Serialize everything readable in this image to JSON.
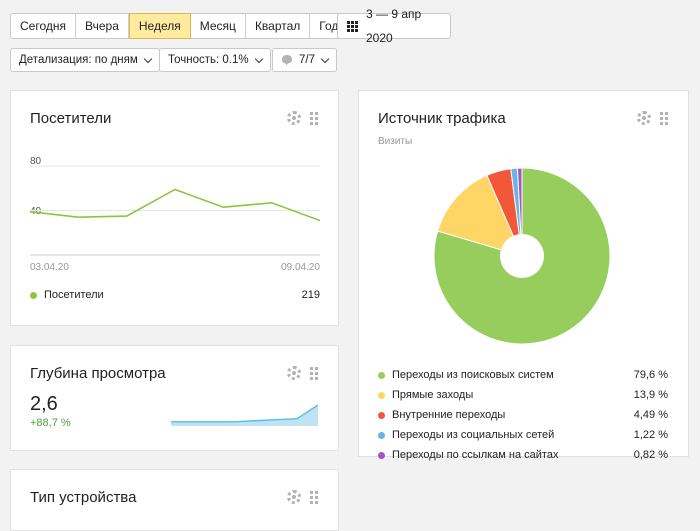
{
  "periods": [
    "Сегодня",
    "Вчера",
    "Неделя",
    "Месяц",
    "Квартал",
    "Год"
  ],
  "active_period": "Неделя",
  "date_range": "3 — 9 апр 2020",
  "detail_label": "Детализация: по дням",
  "accuracy_label": "Точность: 0.1%",
  "segments_label": "7/7",
  "visitors_card": {
    "title": "Посетители",
    "y_ticks": [
      "80",
      "40"
    ],
    "x_start": "03.04.20",
    "x_end": "09.04.20",
    "legend_label": "Посетители",
    "legend_value": "219",
    "color": "#8cc63f"
  },
  "depth_card": {
    "title": "Глубина просмотра",
    "value": "2,6",
    "change": "+88,7 %",
    "color": "#5bbde4"
  },
  "device_card": {
    "title": "Тип устройства"
  },
  "traffic_card": {
    "title": "Источник трафика",
    "subtitle": "Визиты",
    "sources": [
      {
        "label": "Переходы из поисковых систем",
        "value": "79,6 %",
        "pct": 79.6,
        "color": "#96cd5d"
      },
      {
        "label": "Прямые заходы",
        "value": "13,9 %",
        "pct": 13.9,
        "color": "#ffd666"
      },
      {
        "label": "Внутренние переходы",
        "value": "4,49 %",
        "pct": 4.49,
        "color": "#f2573a"
      },
      {
        "label": "Переходы из социальных сетей",
        "value": "1,22 %",
        "pct": 1.22,
        "color": "#6db2e6"
      },
      {
        "label": "Переходы по ссылкам на сайтах",
        "value": "0,82 %",
        "pct": 0.82,
        "color": "#a254c9"
      }
    ]
  },
  "chart_data": [
    {
      "type": "line",
      "title": "Посетители",
      "x": [
        "03.04.20",
        "04.04.20",
        "05.04.20",
        "06.04.20",
        "07.04.20",
        "08.04.20",
        "09.04.20"
      ],
      "series": [
        {
          "name": "Посетители",
          "values": [
            39,
            34,
            35,
            59,
            43,
            47,
            31
          ]
        }
      ],
      "ylim": [
        0,
        90
      ]
    },
    {
      "type": "pie",
      "title": "Источник трафика",
      "categories": [
        "Переходы из поисковых систем",
        "Прямые заходы",
        "Внутренние переходы",
        "Переходы из социальных сетей",
        "Переходы по ссылкам на сайтах"
      ],
      "values": [
        79.6,
        13.9,
        4.49,
        1.22,
        0.82
      ]
    },
    {
      "type": "area",
      "title": "Глубина просмотра",
      "values": [
        0.2,
        0.2,
        0.2,
        0.2,
        0.25,
        0.3,
        0.35,
        1.0
      ]
    }
  ]
}
